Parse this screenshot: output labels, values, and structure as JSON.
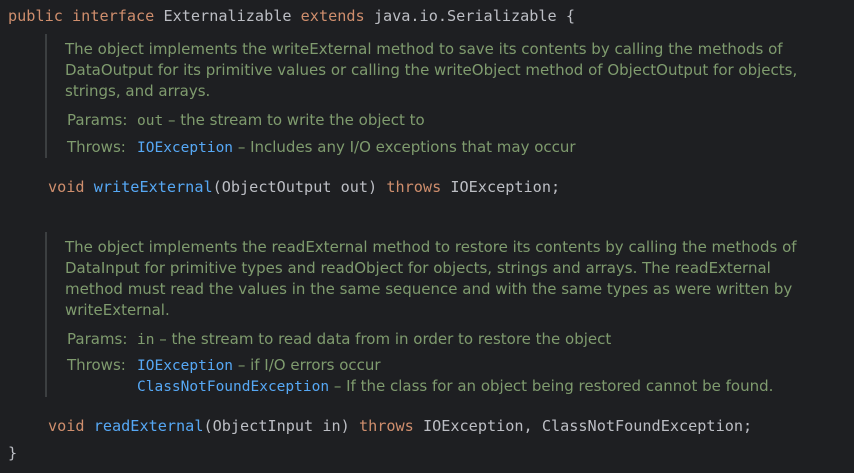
{
  "interface_decl": {
    "kw_public": "public",
    "kw_interface": "interface",
    "name": "Externalizable",
    "kw_extends": "extends",
    "parent": "java.io.Serializable",
    "open_brace": "{"
  },
  "write_doc": {
    "description": "The object implements the writeExternal method to save its contents by calling the methods of DataOutput for its primitive values or calling the writeObject method of ObjectOutput for objects, strings, and arrays.",
    "params_label": "Params:",
    "param_name": "out",
    "param_desc": "– the stream to write the object to",
    "throws_label": "Throws:",
    "throws_type": "IOException",
    "throws_desc": "– Includes any I/O exceptions that may occur"
  },
  "write_method": {
    "kw_void": "void",
    "name": "writeExternal",
    "signature": "(ObjectOutput out)",
    "kw_throws": "throws",
    "exceptions": "IOException;"
  },
  "read_doc": {
    "description": "The object implements the readExternal method to restore its contents by calling the methods of DataInput for primitive types and readObject for objects, strings and arrays. The readExternal method must read the values in the same sequence and with the same types as were written by writeExternal.",
    "params_label": "Params:",
    "param_name": "in",
    "param_desc": "– the stream to read data from in order to restore the object",
    "throws_label": "Throws:",
    "throws_type_1": "IOException",
    "throws_desc_1": "– if I/O errors occur",
    "throws_type_2": "ClassNotFoundException",
    "throws_desc_2": "– If the class for an object being restored cannot be found."
  },
  "read_method": {
    "kw_void": "void",
    "name": "readExternal",
    "signature": "(ObjectInput in)",
    "kw_throws": "throws",
    "exceptions": "IOException, ClassNotFoundException;"
  },
  "close_brace": "}"
}
